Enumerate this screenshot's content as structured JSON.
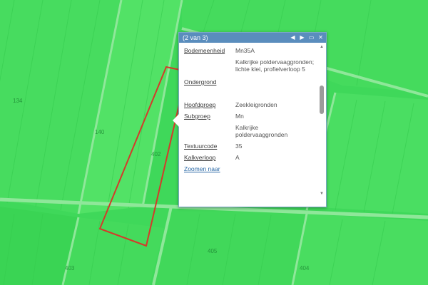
{
  "map": {
    "parcel_labels": [
      "134",
      "140",
      "402",
      "405",
      "403",
      "404"
    ],
    "colors": {
      "base": "#3fd85a",
      "field_light": "#57e468",
      "field_dark": "#33c94c",
      "road": "#8fe79a",
      "selection": "#d43a2a"
    }
  },
  "popup": {
    "title": "(2 van 3)",
    "icons": [
      "prev-icon",
      "next-icon",
      "maximize-icon",
      "close-icon"
    ],
    "prev_glyph": "◀",
    "next_glyph": "▶",
    "maximize_glyph": "▭",
    "close_glyph": "✕",
    "fields": [
      {
        "label": "Bodemeenheid",
        "value": "Mn35A"
      },
      {
        "label": "",
        "value": "Kalkrijke poldervaaggronden; lichte klei, profielverloop 5"
      },
      {
        "label": "Ondergrond",
        "value": ""
      },
      {
        "label": "",
        "value": ""
      },
      {
        "label": "Hoofdgroep",
        "value": "Zeekleigronden"
      },
      {
        "label": "Subgroep",
        "value": "Mn"
      },
      {
        "label": "",
        "value": "Kalkrijke poldervaaggronden"
      },
      {
        "label": "Textuurcode",
        "value": "35"
      },
      {
        "label": "Kalkverloop",
        "value": "A"
      }
    ],
    "zoom_link": "Zoomen naar"
  }
}
